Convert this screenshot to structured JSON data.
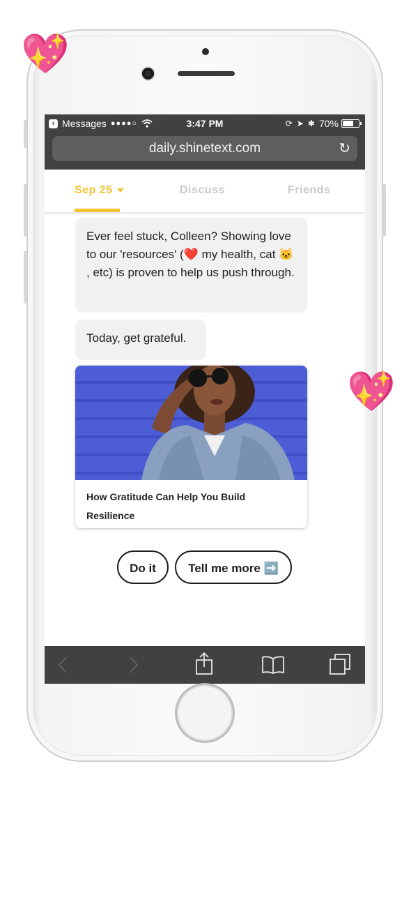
{
  "status_bar": {
    "back_label": "Messages",
    "signal": "●●●●○",
    "wifi_icon": "wifi-icon",
    "time": "3:47 PM",
    "battery_percent": "70%",
    "battery_level": 0.7
  },
  "browser": {
    "url": "daily.shinetext.com",
    "reload_icon": "reload-icon"
  },
  "tabs": [
    {
      "label": "Sep 25",
      "active": true
    },
    {
      "label": "Discuss",
      "active": false
    },
    {
      "label": "Friends",
      "active": false
    }
  ],
  "messages": [
    {
      "text": "Ever feel stuck, Colleen? Showing love to our 'resources' (❤️ my health, cat 🐱 , etc) is proven to help us push through."
    },
    {
      "text": "Today, get grateful."
    }
  ],
  "article_card": {
    "title": "How Gratitude Can Help You Build Resilience",
    "image_icon": "photo-of-woman-in-sunglasses"
  },
  "actions": {
    "do_it": "Do it",
    "tell_more": "Tell me more ➡️"
  },
  "toolbar": {
    "icons": [
      "back-arrow-icon",
      "forward-arrow-icon",
      "share-icon",
      "bookmarks-icon",
      "tabs-icon"
    ]
  },
  "decorations": {
    "heart_emoji": "💖"
  },
  "colors": {
    "accent": "#f2c233",
    "browser_chrome": "#414141",
    "bubble": "#f1f1f1"
  }
}
